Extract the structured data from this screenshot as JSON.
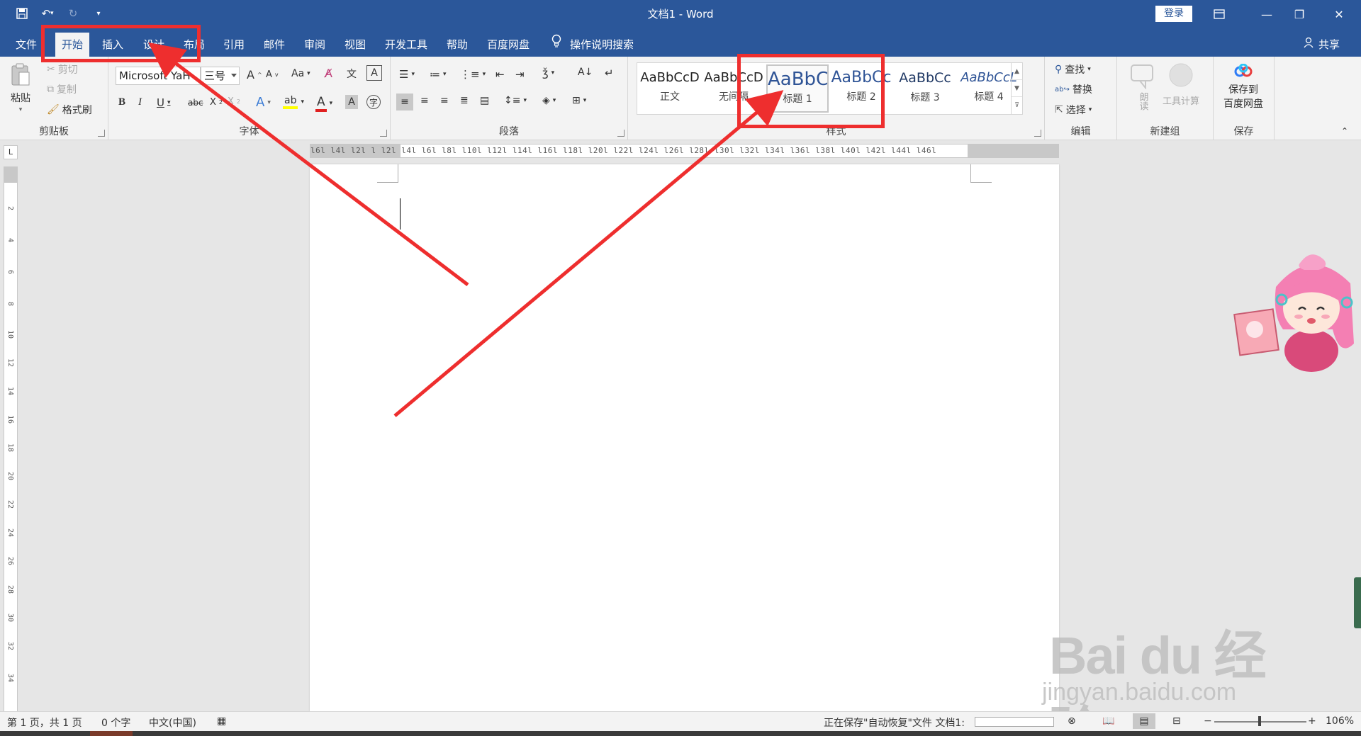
{
  "window": {
    "title": "文档1  -  Word",
    "login_label": "登录"
  },
  "tabs": [
    {
      "label": "文件"
    },
    {
      "label": "开始"
    },
    {
      "label": "插入"
    },
    {
      "label": "设计"
    },
    {
      "label": "布局"
    },
    {
      "label": "引用"
    },
    {
      "label": "邮件"
    },
    {
      "label": "审阅"
    },
    {
      "label": "视图"
    },
    {
      "label": "开发工具"
    },
    {
      "label": "帮助"
    },
    {
      "label": "百度网盘"
    }
  ],
  "tell_me": "操作说明搜索",
  "share_label": "共享",
  "ribbon": {
    "clipboard": {
      "label": "剪贴板",
      "paste": "粘贴",
      "cut": "剪切",
      "copy": "复制",
      "format_painter": "格式刷"
    },
    "font": {
      "label": "字体",
      "font_name": "Microsoft YaH",
      "font_size": "三号"
    },
    "paragraph": {
      "label": "段落"
    },
    "styles": {
      "label": "样式",
      "items": [
        {
          "sample": "AaBbCcD",
          "name": "正文"
        },
        {
          "sample": "AaBbCcD",
          "name": "无间隔"
        },
        {
          "sample": "AaBbC",
          "name": "标题 1"
        },
        {
          "sample": "AaBbCc",
          "name": "标题 2"
        },
        {
          "sample": "AaBbCc",
          "name": "标题 3"
        },
        {
          "sample": "AaBbCcL",
          "name": "标题 4"
        }
      ]
    },
    "editing": {
      "label": "编辑",
      "find": "查找",
      "replace": "替换",
      "select": "选择"
    },
    "new_group": {
      "label": "新建组",
      "read_aloud": "朗读",
      "tool_calc": "工具计算"
    },
    "save": {
      "label": "保存",
      "save_to": "保存到",
      "baidu_disk": "百度网盘"
    }
  },
  "ruler_text": "l6l  l4l  l2l  l    l2l  l4l  l6l  l8l  l10l  l12l  l14l  l16l  l18l  l20l  l22l  l24l  l26l  l28l  l30l  l32l  l34l  l36l  l38l  l40l  l42l  l44l  l46l",
  "vruler_marks": [
    "2",
    "4",
    "6",
    "8",
    "10",
    "12",
    "14",
    "16",
    "18",
    "20",
    "22",
    "24",
    "26",
    "28",
    "30",
    "32",
    "34"
  ],
  "status": {
    "page": "第 1 页，共 1 页",
    "words": "0 个字",
    "language": "中文(中国)",
    "saving": "正在保存\"自动恢复\"文件 文档1:",
    "zoom": "106%"
  },
  "watermark": {
    "main": "Bai du 经验",
    "sub": "jingyan.baidu.com"
  },
  "colors": {
    "brand": "#2b579a",
    "annotation": "#ee2e2e"
  }
}
